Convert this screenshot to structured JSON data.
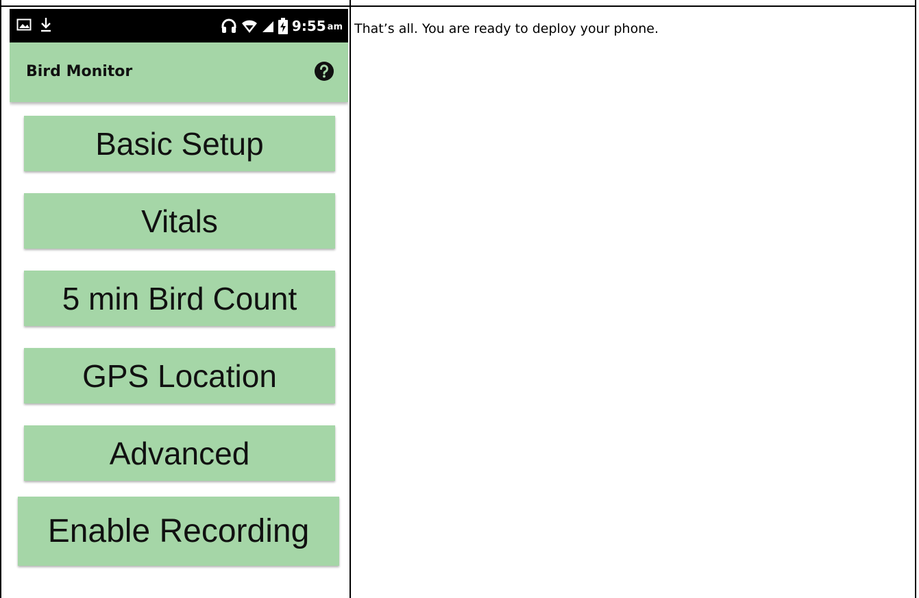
{
  "instruction_text": "That’s all. You are ready to deploy your phone.",
  "statusbar": {
    "left_icons": [
      "image-icon",
      "download-icon"
    ],
    "right_icons": [
      "headset-icon",
      "wifi-icon",
      "signal-icon",
      "battery-charging-icon"
    ],
    "time": "9:55",
    "ampm": "am"
  },
  "appbar": {
    "title": "Bird Monitor",
    "help_icon": "help-icon",
    "color": "#a5d6a7"
  },
  "menu": {
    "items": [
      {
        "label": "Basic Setup"
      },
      {
        "label": "Vitals"
      },
      {
        "label": "5 min Bird Count"
      },
      {
        "label": "GPS Location"
      },
      {
        "label": "Advanced"
      },
      {
        "label": "Enable Recording"
      }
    ]
  }
}
